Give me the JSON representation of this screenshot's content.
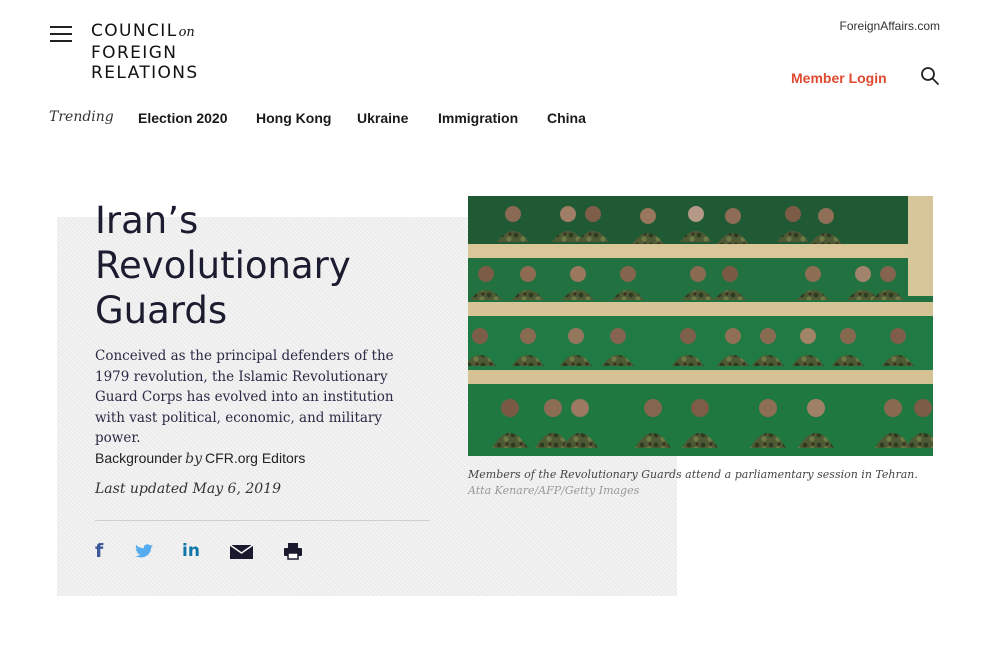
{
  "header": {
    "logo_line1": "COUNCIL",
    "logo_on": "on",
    "logo_line2": "FOREIGN",
    "logo_line3": "RELATIONS",
    "foreign_affairs": "ForeignAffairs.com",
    "member_login": "Member Login"
  },
  "trending": {
    "label": "Trending",
    "items": [
      "Election 2020",
      "Hong Kong",
      "Ukraine",
      "Immigration",
      "China"
    ]
  },
  "article": {
    "title": "Iran’s Revolutionary Guards",
    "summary": "Conceived as the principal defenders of the 1979 revolution, the Islamic Revolutionary Guard Corps has evolved into an institution with vast political, economic, and military power.",
    "type": "Backgrounder",
    "by": "by",
    "author": "CFR.org Editors",
    "updated": "Last updated May 6, 2019"
  },
  "share": {
    "facebook": "f",
    "linkedin": "in"
  },
  "image": {
    "caption": "Members of the Revolutionary Guards attend a parliamentary session in Tehran.",
    "credit": "Atta Kenare/AFP/Getty Images"
  },
  "colors": {
    "accent": "#e04a2f",
    "facebook": "#3b5998",
    "twitter": "#55acee",
    "linkedin": "#0e76a8"
  },
  "icons": [
    "menu-icon",
    "search-icon",
    "facebook-icon",
    "twitter-icon",
    "linkedin-icon",
    "email-icon",
    "print-icon"
  ]
}
